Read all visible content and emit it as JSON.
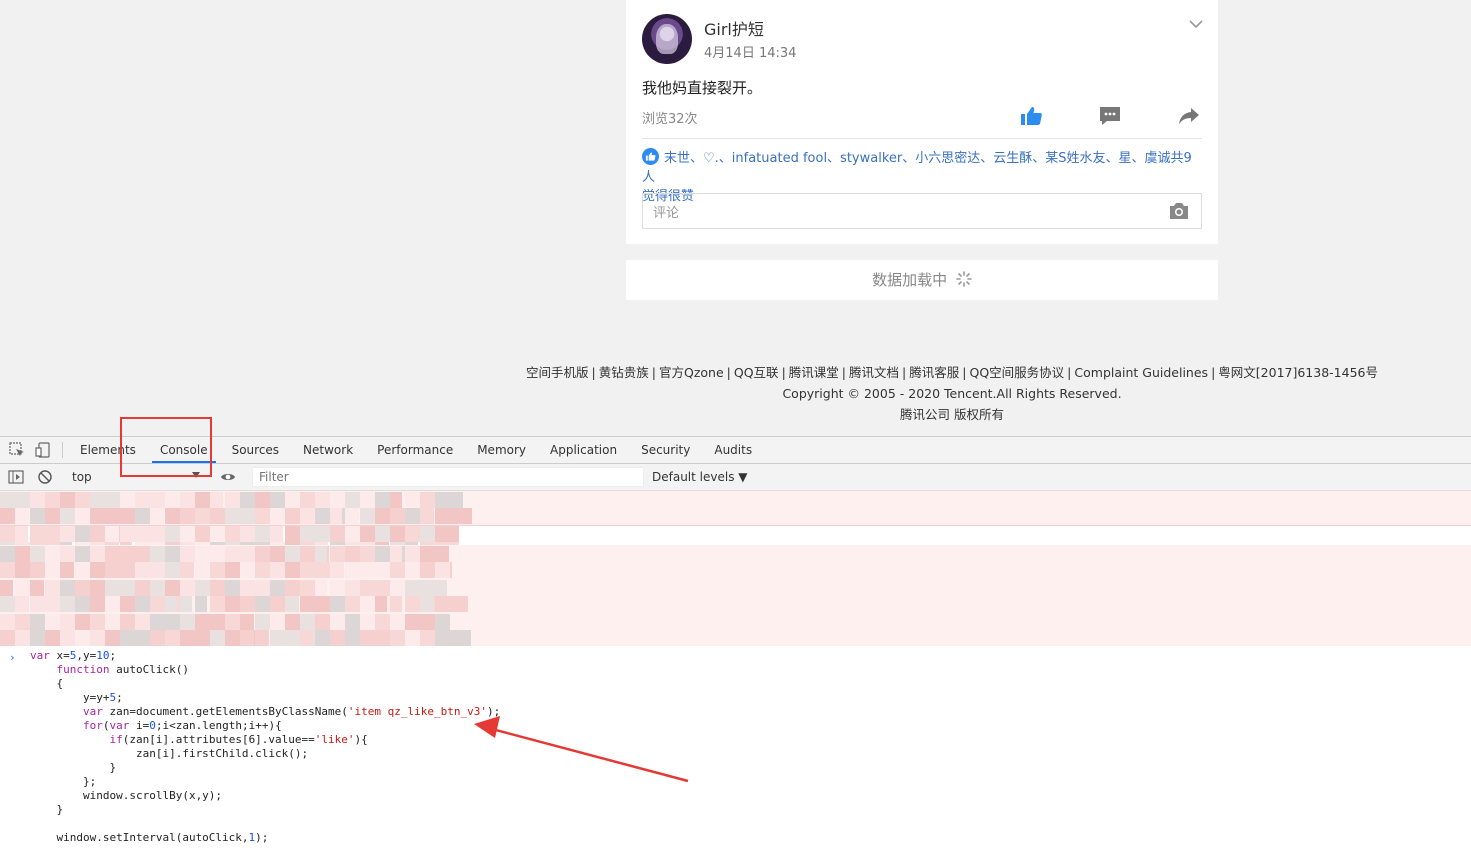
{
  "post": {
    "username": "Girl护短",
    "time": "4月14日 14:34",
    "text": "我他妈直接裂开。",
    "views": "浏览32次",
    "likes_names": "末世、♡.、infatuated fool、stywalker、小六思密达、云生酥、某S姓水友、星、虞诚共9人",
    "likes_tail": "觉得很赞",
    "comment_placeholder": "评论"
  },
  "loading_text": "数据加载中",
  "footer": {
    "links": [
      "空间手机版",
      "黄钻贵族",
      "官方Qzone",
      "QQ互联",
      "腾讯课堂",
      "腾讯文档",
      "腾讯客服",
      "QQ空间服务协议",
      "Complaint Guidelines",
      "粤网文[2017]6138-1456号"
    ],
    "copyright": "Copyright © 2005 - 2020 Tencent.All Rights Reserved.",
    "rights": "腾讯公司 版权所有"
  },
  "devtools": {
    "tabs": [
      "Elements",
      "Console",
      "Sources",
      "Network",
      "Performance",
      "Memory",
      "Application",
      "Security",
      "Audits"
    ],
    "active_tab": "Console",
    "context": "top",
    "filter_placeholder": "Filter",
    "levels": "Default levels ▼",
    "code_lines": [
      "var x=5,y=10;",
      "    function autoClick()",
      "    {",
      "        y=y+5;",
      "        var zan=document.getElementsByClassName('item qz_like_btn_v3');",
      "        for(var i=0;i<zan.length;i++){",
      "            if(zan[i].attributes[6].value=='like'){",
      "                zan[i].firstChild.click();",
      "            }",
      "        };",
      "        window.scrollBy(x,y);",
      "    }",
      "",
      "    window.setInterval(autoClick,1);"
    ]
  },
  "colors": {
    "accent": "#1a73e8",
    "like_blue": "#2d8cf0",
    "highlight_red": "#e53935",
    "error_bg": "#fff0f0"
  }
}
